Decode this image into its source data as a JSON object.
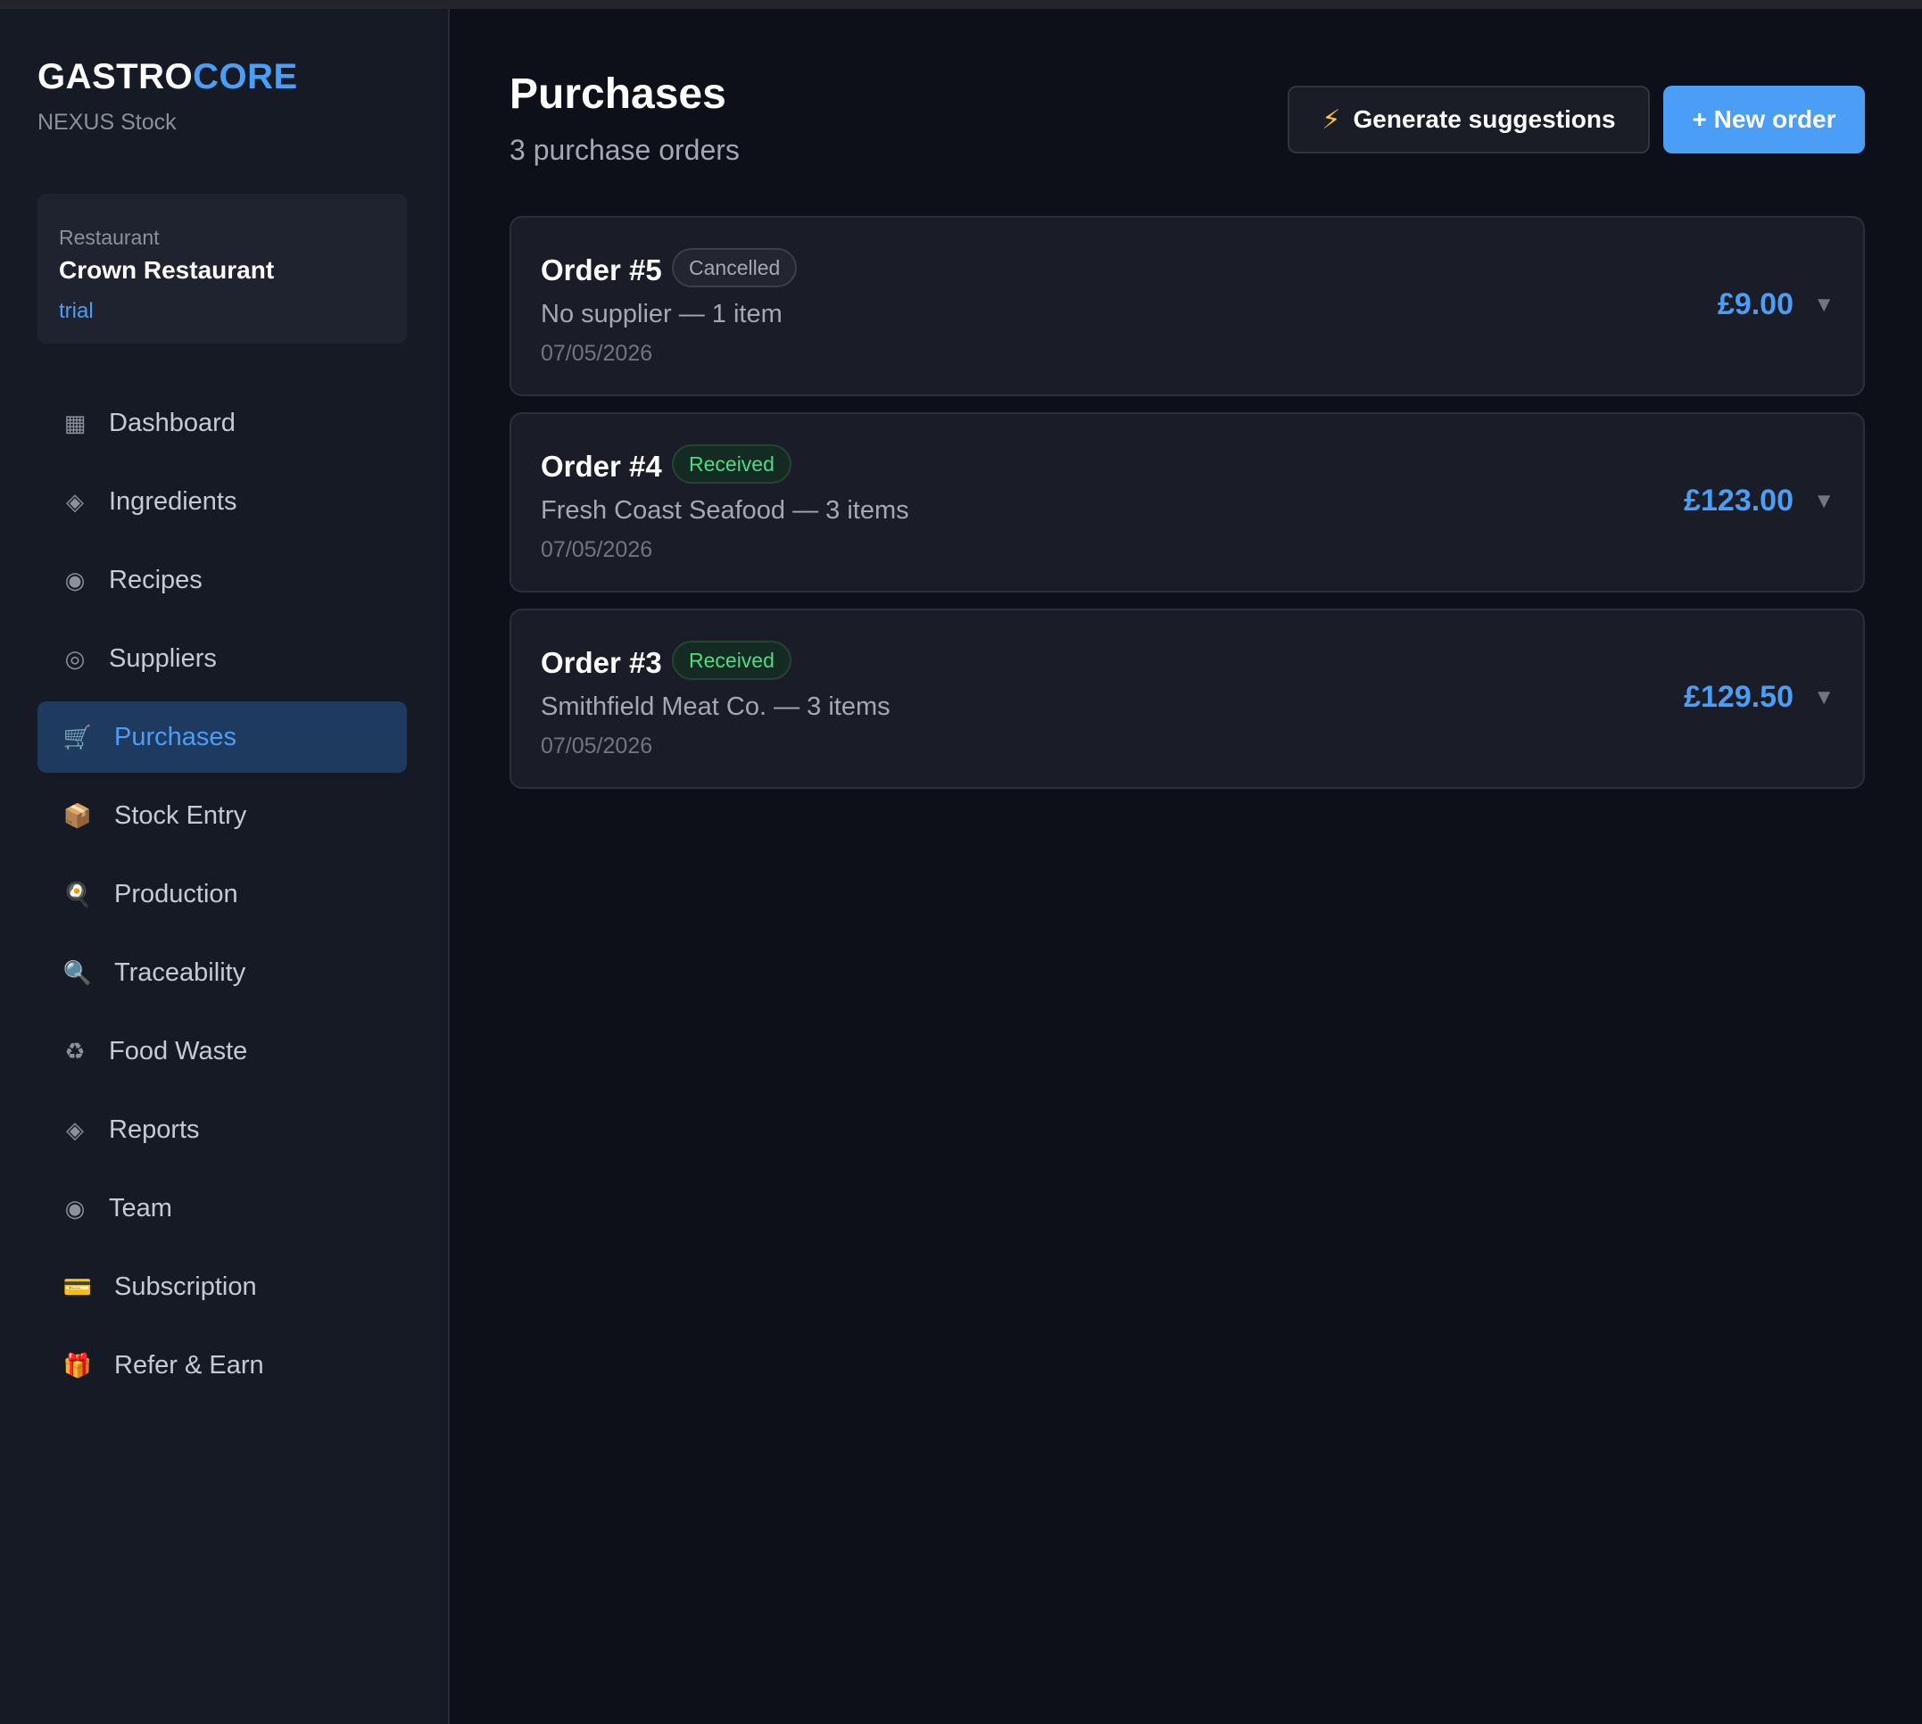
{
  "brand": {
    "part1": "GASTRO",
    "part2": "CORE",
    "subtitle": "NEXUS Stock"
  },
  "restaurant": {
    "label": "Restaurant",
    "name": "Crown Restaurant",
    "plan": "trial"
  },
  "nav": [
    {
      "icon": "▦",
      "label": "Dashboard"
    },
    {
      "icon": "◈",
      "label": "Ingredients"
    },
    {
      "icon": "◉",
      "label": "Recipes"
    },
    {
      "icon": "◎",
      "label": "Suppliers"
    },
    {
      "icon": "🛒",
      "label": "Purchases"
    },
    {
      "icon": "📦",
      "label": "Stock Entry"
    },
    {
      "icon": "🍳",
      "label": "Production"
    },
    {
      "icon": "🔍",
      "label": "Traceability"
    },
    {
      "icon": "♻",
      "label": "Food Waste"
    },
    {
      "icon": "◈",
      "label": "Reports"
    },
    {
      "icon": "◉",
      "label": "Team"
    },
    {
      "icon": "💳",
      "label": "Subscription"
    },
    {
      "icon": "🎁",
      "label": "Refer & Earn"
    }
  ],
  "page": {
    "title": "Purchases",
    "subtitle": "3 purchase orders"
  },
  "actions": {
    "generate_icon": "⚡",
    "generate_label": "Generate suggestions",
    "new_order_label": "+ New order"
  },
  "orders": [
    {
      "title": "Order #5",
      "status": "Cancelled",
      "description": "No supplier — 1 item",
      "date": "07/05/2026",
      "amount": "£9.00",
      "chevron": "▼"
    },
    {
      "title": "Order #4",
      "status": "Received",
      "description": "Fresh Coast Seafood — 3 items",
      "date": "07/05/2026",
      "amount": "£123.00",
      "chevron": "▼"
    },
    {
      "title": "Order #3",
      "status": "Received",
      "description": "Smithfield Meat Co. — 3 items",
      "date": "07/05/2026",
      "amount": "£129.50",
      "chevron": "▼"
    }
  ],
  "colors": {
    "accent": "#4a9ef5",
    "received": "#4ade80",
    "background": "#0d1018",
    "sidebar": "#161a24"
  }
}
